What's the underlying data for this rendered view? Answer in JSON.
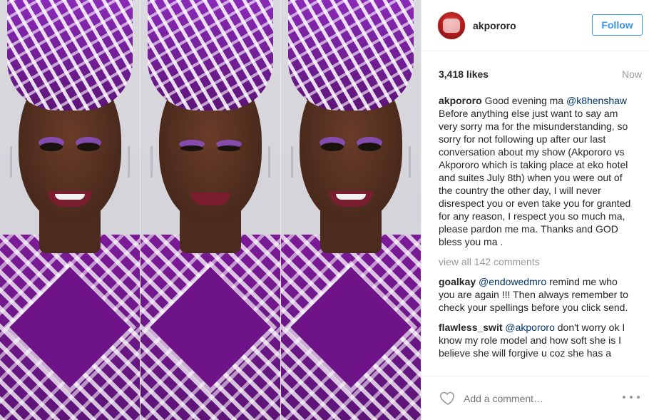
{
  "post": {
    "username": "akpororo",
    "follow_label": "Follow",
    "likes": "3,418 likes",
    "timestamp": "Now",
    "comments": [
      {
        "user": "akpororo",
        "parts": [
          {
            "t": "text",
            "v": "Good evening ma "
          },
          {
            "t": "mention",
            "v": "@k8henshaw"
          },
          {
            "t": "text",
            "v": " Before anything else just want to say am very sorry ma for the misunderstanding, so sorry for not following up after our last conversation about my show (Akpororo vs Akpororo which is taking place at eko hotel and suites July 8th) when you were out of the country the other day, I will never disrespect you or even take you for granted for any reason, I respect you so much ma, please pardon me ma. Thanks and GOD bless you ma ."
          }
        ]
      },
      {
        "user": "goalkay",
        "parts": [
          {
            "t": "mention",
            "v": "@endowedmro"
          },
          {
            "t": "text",
            "v": " remind me who you are again !!! Then always remember to check your spellings before you click send."
          }
        ]
      },
      {
        "user": "flawless_swit",
        "parts": [
          {
            "t": "mention",
            "v": "@akpororo"
          },
          {
            "t": "text",
            "v": " don't worry ok I know my role model and how soft she is I believe she will forgive u coz she has a"
          }
        ]
      }
    ],
    "view_all": "view all 142 comments",
    "add_comment_placeholder": "Add a comment…"
  },
  "colors": {
    "accent": "#3897f0",
    "mention": "#003569",
    "muted": "#999999",
    "text": "#262626"
  },
  "icons": {
    "like": "heart-icon",
    "more": "more-options-icon"
  }
}
